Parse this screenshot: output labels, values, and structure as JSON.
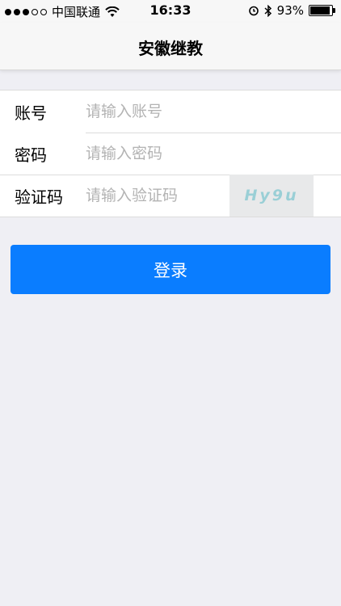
{
  "status": {
    "carrier": "中国联通",
    "time": "16:33",
    "battery": "93%",
    "battery_level": 0.93
  },
  "nav": {
    "title": "安徽继教"
  },
  "form": {
    "account_label": "账号",
    "account_placeholder": "请输入账号",
    "password_label": "密码",
    "password_placeholder": "请输入密码",
    "captcha_label": "验证码",
    "captcha_placeholder": "请输入验证码",
    "captcha_text": "Hy9u"
  },
  "login_label": "登录",
  "colors": {
    "accent": "#0a7dff",
    "background": "#efeff4",
    "captcha_text": "#9acfd6"
  }
}
